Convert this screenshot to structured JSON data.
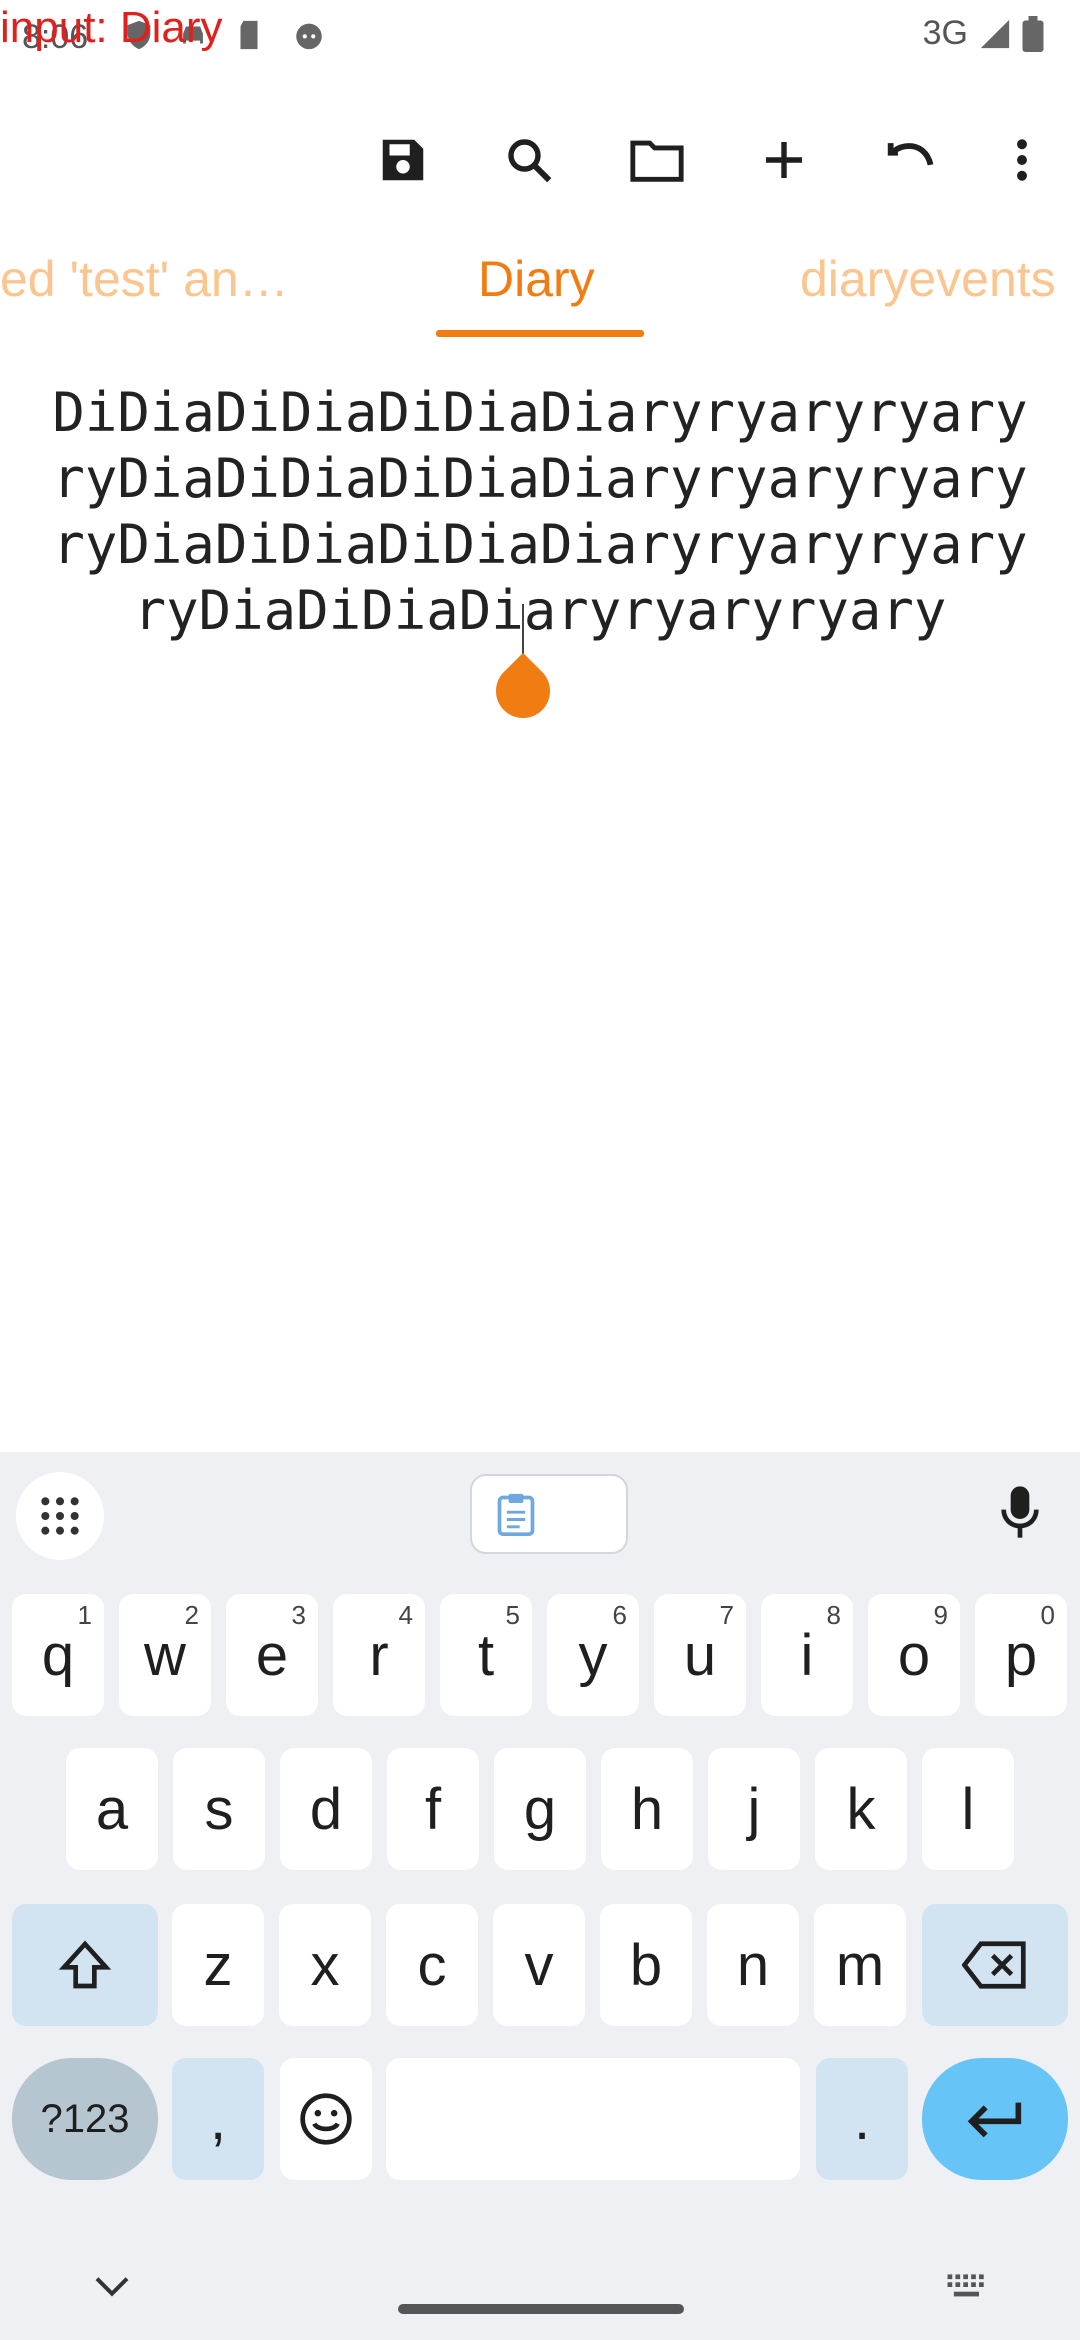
{
  "debug": {
    "input_label": "input: Diary"
  },
  "status_bar": {
    "time": "8:06",
    "network": "3G"
  },
  "toolbar": {
    "icons": [
      "save-icon",
      "search-icon",
      "folder-icon",
      "add-icon",
      "undo-icon",
      "more-vert-icon"
    ]
  },
  "tabs": [
    {
      "label": "ed 'test' an…",
      "active": false
    },
    {
      "label": "Diary",
      "active": true
    },
    {
      "label": "diaryevents",
      "active": false
    }
  ],
  "colors": {
    "accent": "#f07c12",
    "inactive_tab": "#fbc58f",
    "enter_key": "#66c5f6"
  },
  "editor": {
    "lines": [
      "DiDiaDiDiaDiDiaDiaryryaryryary",
      "ryDiaDiDiaDiDiaDiaryryaryryary",
      "ryDiaDiDiaDiDiaDiaryryaryryary",
      "ryDiaDiDiaDiaryryaryryary"
    ]
  },
  "keyboard": {
    "row1": [
      {
        "k": "q",
        "h": "1"
      },
      {
        "k": "w",
        "h": "2"
      },
      {
        "k": "e",
        "h": "3"
      },
      {
        "k": "r",
        "h": "4"
      },
      {
        "k": "t",
        "h": "5"
      },
      {
        "k": "y",
        "h": "6"
      },
      {
        "k": "u",
        "h": "7"
      },
      {
        "k": "i",
        "h": "8"
      },
      {
        "k": "o",
        "h": "9"
      },
      {
        "k": "p",
        "h": "0"
      }
    ],
    "row2": [
      "a",
      "s",
      "d",
      "f",
      "g",
      "h",
      "j",
      "k",
      "l"
    ],
    "row3": [
      "z",
      "x",
      "c",
      "v",
      "b",
      "n",
      "m"
    ],
    "symbols_label": "?123",
    "comma": ",",
    "period": "."
  }
}
